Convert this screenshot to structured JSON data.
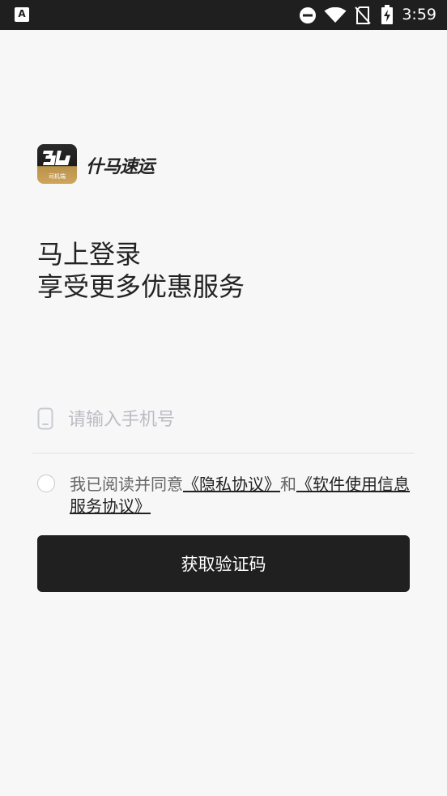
{
  "status_bar": {
    "app_icon_letter": "A",
    "time": "3:59",
    "icons": [
      "dnd-icon",
      "wifi-icon",
      "no-sim-icon",
      "battery-charging-icon"
    ]
  },
  "brand": {
    "logo_sub_text": "司机端",
    "wordmark": "什马速运"
  },
  "headline": {
    "line1": "马上登录",
    "line2": "享受更多优惠服务"
  },
  "phone": {
    "placeholder": "请输入手机号",
    "value": ""
  },
  "agreement": {
    "prefix": "我已阅读并同意",
    "privacy_link": "《隐私协议》",
    "conjunction": "和",
    "service_link": "《软件使用信息服务协议》",
    "checked": false
  },
  "button": {
    "label": "获取验证码"
  },
  "colors": {
    "background": "#f7f7f7",
    "status_bar": "#1f1f1f",
    "button": "#202020",
    "placeholder": "#bcbcc4",
    "logo_gold": "#cfa55d"
  }
}
